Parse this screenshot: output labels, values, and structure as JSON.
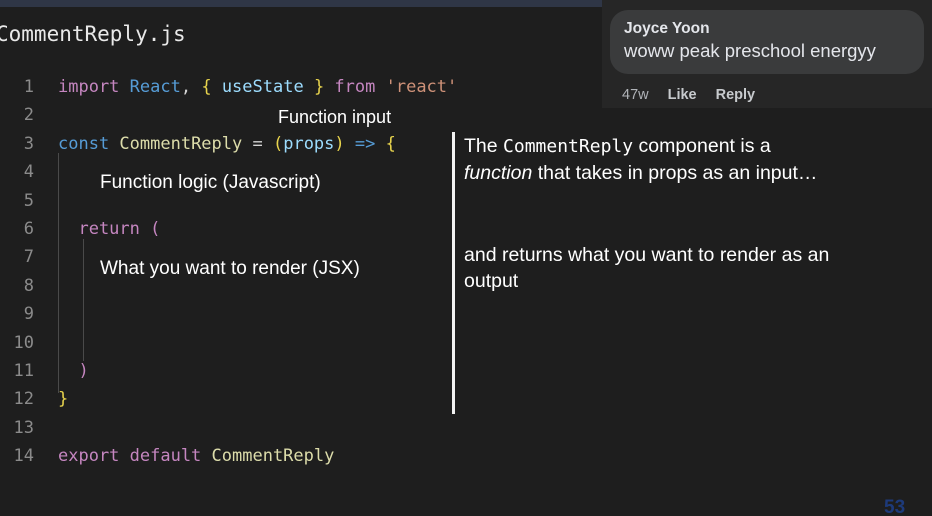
{
  "window": {
    "filename": "CommentReply.js",
    "background_color": "#1e1e1e",
    "top_strip_color": "#2f3646"
  },
  "editor": {
    "line_numbers": [
      "1",
      "2",
      "3",
      "4",
      "5",
      "6",
      "7",
      "8",
      "9",
      "10",
      "11",
      "12",
      "13",
      "14"
    ],
    "lines": [
      {
        "number": "1",
        "tokens": [
          {
            "text": "import ",
            "color": "#c586c0"
          },
          {
            "text": "React",
            "color": "#569cd6"
          },
          {
            "text": ", ",
            "color": "#d4d4d4"
          },
          {
            "text": "{ ",
            "color": "#e8d44d"
          },
          {
            "text": "useState",
            "color": "#9cdcfe"
          },
          {
            "text": " }",
            "color": "#e8d44d"
          },
          {
            "text": " from ",
            "color": "#c586c0"
          },
          {
            "text": "'react'",
            "color": "#ce9178"
          }
        ]
      },
      {
        "number": "2",
        "tokens": []
      },
      {
        "number": "3",
        "tokens": [
          {
            "text": "const ",
            "color": "#569cd6"
          },
          {
            "text": "CommentReply",
            "color": "#dcdcaa"
          },
          {
            "text": " = ",
            "color": "#d4d4d4"
          },
          {
            "text": "(",
            "color": "#e8d44d"
          },
          {
            "text": "props",
            "color": "#9cdcfe"
          },
          {
            "text": ")",
            "color": "#e8d44d"
          },
          {
            "text": " =>",
            "color": "#569cd6"
          },
          {
            "text": " {",
            "color": "#e8d44d"
          }
        ]
      },
      {
        "number": "4",
        "tokens": []
      },
      {
        "number": "5",
        "tokens": []
      },
      {
        "number": "6",
        "tokens": [
          {
            "text": "  return ",
            "color": "#c586c0"
          },
          {
            "text": "(",
            "color": "#c586c0"
          }
        ]
      },
      {
        "number": "7",
        "tokens": []
      },
      {
        "number": "8",
        "tokens": []
      },
      {
        "number": "9",
        "tokens": []
      },
      {
        "number": "10",
        "tokens": []
      },
      {
        "number": "11",
        "tokens": [
          {
            "text": "  )",
            "color": "#c586c0"
          }
        ]
      },
      {
        "number": "12",
        "tokens": [
          {
            "text": "}",
            "color": "#e8d44d"
          }
        ]
      },
      {
        "number": "13",
        "tokens": []
      },
      {
        "number": "14",
        "tokens": [
          {
            "text": "export default ",
            "color": "#c586c0"
          },
          {
            "text": "CommentReply",
            "color": "#dcdcaa"
          }
        ]
      }
    ]
  },
  "annotations": {
    "function_input": "Function input",
    "function_logic": "Function logic (Javascript)",
    "render_jsx": "What you want to render (JSX)"
  },
  "explanation": {
    "para1_prefix": "The ",
    "para1_code": "CommentReply",
    "para1_mid": " component is a ",
    "para1_italic": "function",
    "para1_suffix": " that takes in props as an input…",
    "para2": "and returns what you want to render as an output"
  },
  "comment_overlay": {
    "author": "Joyce Yoon",
    "text": "woww peak preschool energyy",
    "timestamp": "47w",
    "like_label": "Like",
    "reply_label": "Reply",
    "bubble_color": "#3a3b3c",
    "panel_color": "#262626"
  },
  "artifacts": {
    "page_number": "53"
  }
}
